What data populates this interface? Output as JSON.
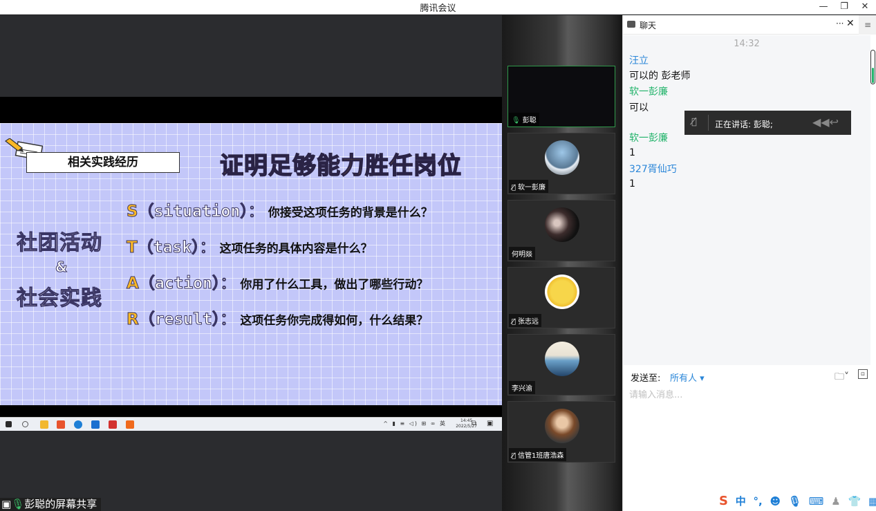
{
  "window": {
    "title": "腾讯会议",
    "minimize": "—",
    "restore": "❐",
    "close": "✕"
  },
  "share": {
    "label": "彭聪的屏幕共享"
  },
  "slide": {
    "section_label": "相关实践经历",
    "heading": "证明足够能力胜任岗位",
    "left_top": "社团活动",
    "left_amp": "&",
    "left_bottom": "社会实践",
    "star": [
      {
        "key": "S",
        "word": "（situation）：",
        "question": "你接受这项任务的背景是什么？"
      },
      {
        "key": "T",
        "word": "（task）：",
        "question": "这项任务的具体内容是什么？"
      },
      {
        "key": "A",
        "word": "（action）：",
        "question": "你用了什么工具，做出了哪些行动？"
      },
      {
        "key": "R",
        "word": "（result）：",
        "question": "这项任务你完成得如何，什么结果？"
      }
    ]
  },
  "taskbar": {
    "time": "14:45",
    "date": "2022/5/27",
    "tray": "^ ▮ ≡ ◁) ⊞ ∞ 英"
  },
  "participants": [
    {
      "name": "彭聪",
      "muted": false,
      "active": true
    },
    {
      "name": "软一彭廉",
      "muted": true
    },
    {
      "name": "何明燚",
      "muted": false
    },
    {
      "name": "张志远",
      "muted": true
    },
    {
      "name": "李兴渝",
      "muted": false
    },
    {
      "name": "信管1班唐浩森",
      "muted": true
    }
  ],
  "chat": {
    "title": "聊天",
    "more": "···",
    "close": "✕",
    "menu": "≡",
    "time": "14:32",
    "messages": [
      {
        "sender": "汪立",
        "text": "可以的 彭老师",
        "color": "blue"
      },
      {
        "sender": "软一彭廉",
        "text": "可以",
        "color": "green"
      },
      {
        "sender": "软一彭廉",
        "text": "1",
        "color": "green"
      },
      {
        "sender": "327胥仙巧",
        "text": "1",
        "color": "blue"
      }
    ],
    "speaking": "正在讲话: 彭聪;",
    "send_to_label": "发送至:",
    "audience": "所有人 ▾",
    "placeholder": "请输入消息..."
  },
  "ime": {
    "items": [
      "中",
      "°,",
      "☻",
      "🎙",
      "⌨",
      "♟",
      "👕",
      "▦"
    ]
  },
  "colors": {
    "slide_bg": "#c3c7f9",
    "accent": "#fbb825",
    "green": "#21b36a",
    "blue": "#2a86d8"
  }
}
